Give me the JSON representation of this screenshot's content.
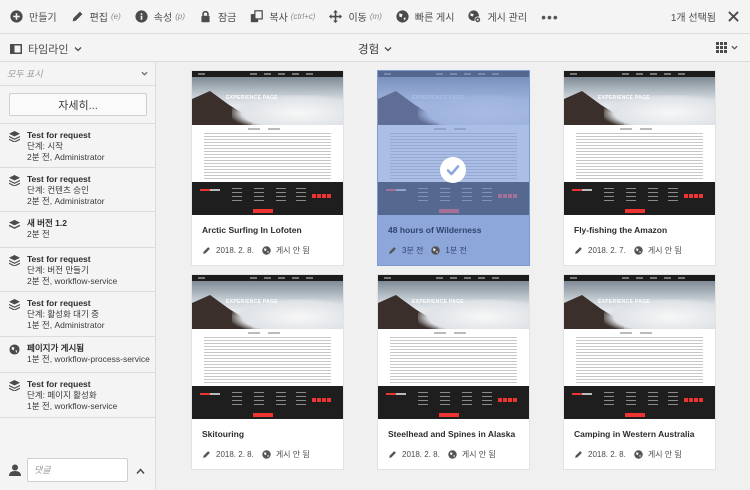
{
  "actionbar": {
    "items": [
      {
        "label": "만들기",
        "shortcut": "",
        "icon": "plus-icon"
      },
      {
        "label": "편집",
        "shortcut": "(e)",
        "icon": "pencil-icon"
      },
      {
        "label": "속성",
        "shortcut": "(p)",
        "icon": "info-icon"
      },
      {
        "label": "잠금",
        "shortcut": "",
        "icon": "lock-icon"
      },
      {
        "label": "복사",
        "shortcut": "(ctrl+c)",
        "icon": "copy-icon"
      },
      {
        "label": "이동",
        "shortcut": "(m)",
        "icon": "move-icon"
      },
      {
        "label": "빠른 게시",
        "shortcut": "",
        "icon": "globe-icon"
      },
      {
        "label": "게시 관리",
        "shortcut": "",
        "icon": "globe-gear-icon"
      }
    ],
    "more": "•••",
    "selection": "1개 선택됨"
  },
  "subbar": {
    "rail_label": "타임라인",
    "title": "경험"
  },
  "rail": {
    "filter": "모두 표시",
    "more_button": "자세히...",
    "entries": [
      {
        "title": "Test for request",
        "lines": [
          "단계: 시작",
          "2분 전, Administrator"
        ],
        "icon": "workflow-icon"
      },
      {
        "title": "Test for request",
        "lines": [
          "단계: 컨텐츠 승인",
          "2분 전, Administrator"
        ],
        "icon": "workflow-icon"
      },
      {
        "title": "새 버전 1.2",
        "lines": [
          "2분 전"
        ],
        "icon": "layers-icon"
      },
      {
        "title": "Test for request",
        "lines": [
          "단계: 버전 만들기",
          "2분 전, workflow-service"
        ],
        "icon": "workflow-icon"
      },
      {
        "title": "Test for request",
        "lines": [
          "단계: 활성화 대기 중",
          "1분 전, Administrator"
        ],
        "icon": "workflow-icon"
      },
      {
        "title": "페이지가 게시됨",
        "lines": [
          "1분 전, workflow-process-service"
        ],
        "icon": "globe-icon"
      },
      {
        "title": "Test for request",
        "lines": [
          "단계: 페이지 활성화",
          "1분 전, workflow-service"
        ],
        "icon": "workflow-icon"
      }
    ],
    "comment_placeholder": "댓글"
  },
  "cards": [
    {
      "title": "Arctic Surfing In Lofoten",
      "modified": "2018. 2. 8.",
      "status": "게시 안 됨",
      "selected": false,
      "hero_title": "EXPERIENCE PAGE"
    },
    {
      "title": "48 hours of Wilderness",
      "modified": "3분 전",
      "status": "1분 전",
      "selected": true,
      "hero_title": "EXPERIENCE PAGE"
    },
    {
      "title": "Fly-fishing the Amazon",
      "modified": "2018. 2. 7.",
      "status": "게시 안 됨",
      "selected": false,
      "hero_title": "EXPERIENCE PAGE"
    },
    {
      "title": "Skitouring",
      "modified": "2018. 2. 8.",
      "status": "게시 안 됨",
      "selected": false,
      "hero_title": "EXPERIENCE PAGE"
    },
    {
      "title": "Steelhead and Spines in Alaska",
      "modified": "2018. 2. 8.",
      "status": "게시 안 됨",
      "selected": false,
      "hero_title": "EXPERIENCE PAGE"
    },
    {
      "title": "Camping in Western Australia",
      "modified": "2018. 2. 8.",
      "status": "게시 안 됨",
      "selected": false,
      "hero_title": "EXPERIENCE PAGE"
    }
  ],
  "colors": {
    "selection": "#8da7db",
    "accent_red": "#e33333"
  }
}
